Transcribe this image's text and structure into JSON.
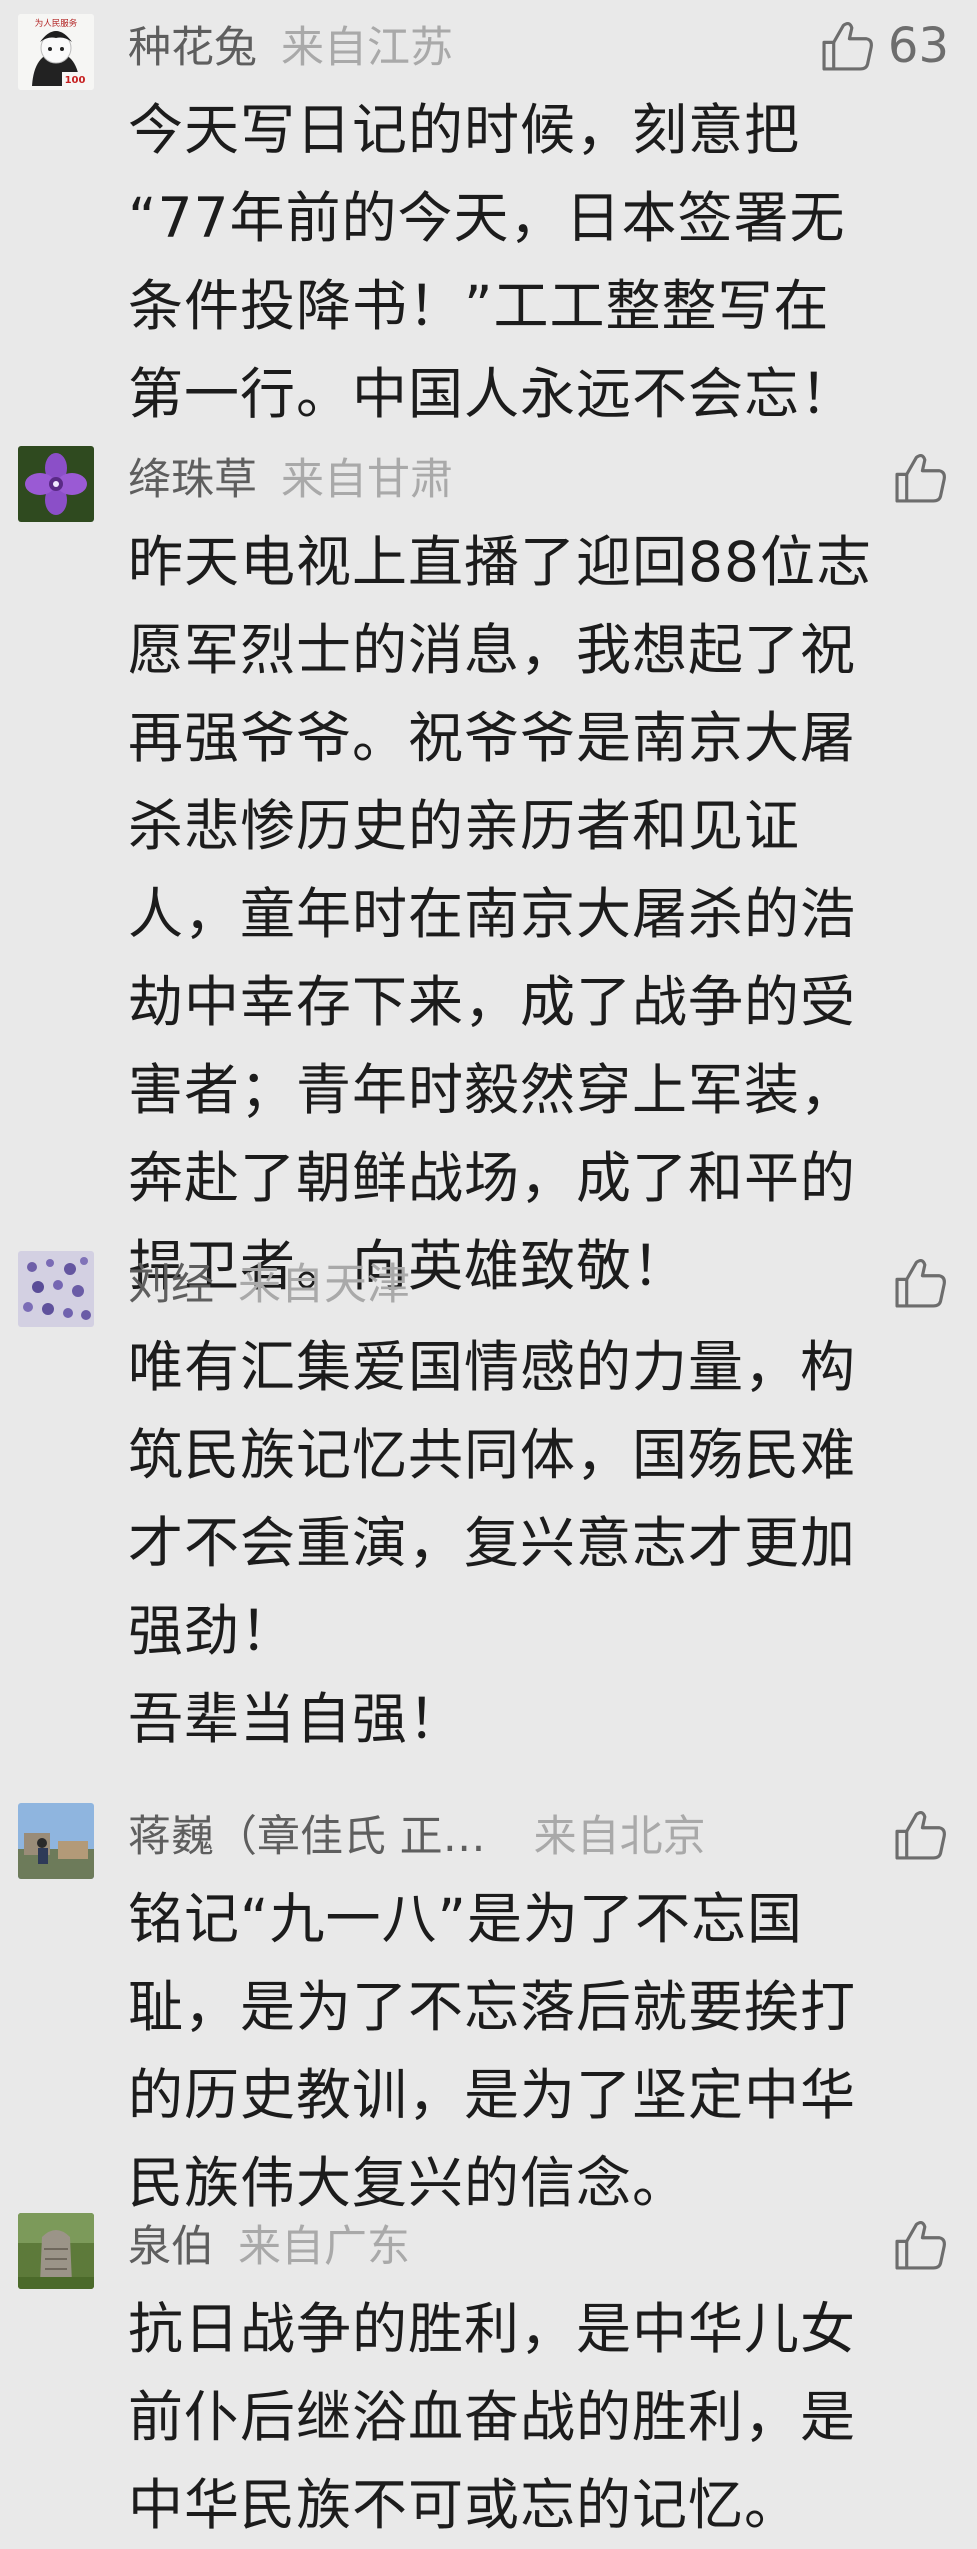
{
  "comments": [
    {
      "username": "种花兔",
      "location": "来自江苏",
      "like_count": "63",
      "avatar_text": "为人民服务",
      "avatar_badge": "100",
      "lines": [
        "今天写日记的时候，刻意把",
        "“77年前的今天，日本签署无",
        "条件投降书！”工工整整写在",
        "第一行。中国人永远不会忘！"
      ]
    },
    {
      "username": "绛珠草",
      "location": "来自甘肃",
      "lines": [
        "昨天电视上直播了迎回88位志",
        "愿军烈士的消息，我想起了祝",
        "再强爷爷。祝爷爷是南京大屠",
        "杀悲惨历史的亲历者和见证",
        "人，童年时在南京大屠杀的浩",
        "劫中幸存下来，成了战争的受",
        "害者；青年时毅然穿上军装，",
        "奔赴了朝鲜战场，成了和平的",
        "捍卫者。向英雄致敬！"
      ]
    },
    {
      "username": "刘经",
      "location": "来自天津",
      "lines": [
        "唯有汇集爱国情感的力量，构",
        "筑民族记忆共同体，国殇民难",
        "才不会重演，复兴意志才更加",
        "强劲！",
        "吾辈当自强！"
      ]
    },
    {
      "username": "蒋巍（章佳氏 正…",
      "location": "来自北京",
      "lines": [
        "铭记“九一八”是为了不忘国",
        "耻，是为了不忘落后就要挨打",
        "的历史教训，是为了坚定中华",
        "民族伟大复兴的信念。"
      ]
    },
    {
      "username": "泉伯",
      "location": "来自广东",
      "lines": [
        "抗日战争的胜利，是中华儿女",
        "前仆后继浴血奋战的胜利，是",
        "中华民族不可或忘的记忆。"
      ]
    }
  ],
  "colors": {
    "background": "#e9e9e9",
    "username": "#5e5e5e",
    "location": "#a9a9a9",
    "body_text": "#1c1c1c",
    "like_icon": "#6d6d6d"
  },
  "icons": {
    "like": "thumbs-up-icon"
  }
}
